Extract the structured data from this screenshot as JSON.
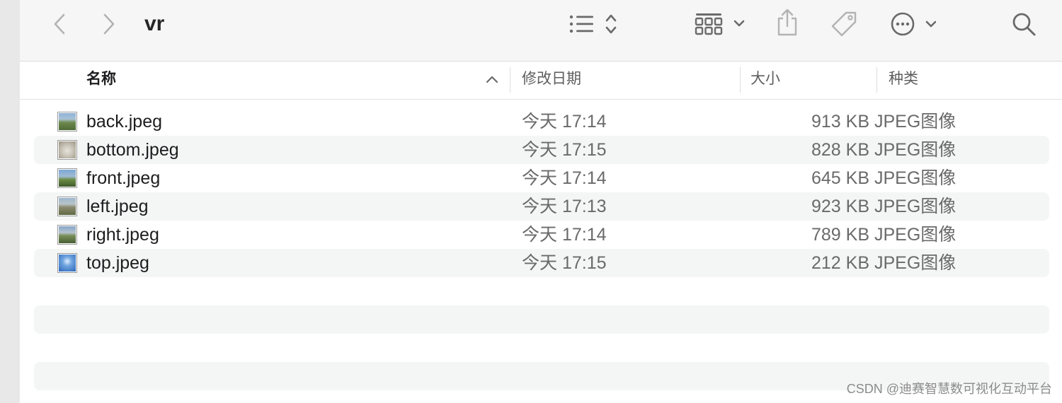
{
  "window": {
    "title": "vr"
  },
  "toolbar": {
    "back_icon": "chevron-left-icon",
    "forward_icon": "chevron-right-icon",
    "list_view_icon": "list-view-icon",
    "group_icon": "grid-group-icon",
    "share_icon": "share-icon",
    "tag_icon": "tag-icon",
    "more_icon": "ellipsis-circle-icon",
    "search_icon": "search-icon"
  },
  "columns": {
    "name": "名称",
    "date": "修改日期",
    "size": "大小",
    "kind": "种类"
  },
  "files": [
    {
      "name": "back.jpeg",
      "date": "今天 17:14",
      "size": "913 KB",
      "kind": "JPEG图像"
    },
    {
      "name": "bottom.jpeg",
      "date": "今天 17:15",
      "size": "828 KB",
      "kind": "JPEG图像"
    },
    {
      "name": "front.jpeg",
      "date": "今天 17:14",
      "size": "645 KB",
      "kind": "JPEG图像"
    },
    {
      "name": "left.jpeg",
      "date": "今天 17:13",
      "size": "923 KB",
      "kind": "JPEG图像"
    },
    {
      "name": "right.jpeg",
      "date": "今天 17:14",
      "size": "789 KB",
      "kind": "JPEG图像"
    },
    {
      "name": "top.jpeg",
      "date": "今天 17:15",
      "size": "212 KB",
      "kind": "JPEG图像"
    }
  ],
  "watermark": "CSDN @迪赛智慧数可视化互动平台"
}
